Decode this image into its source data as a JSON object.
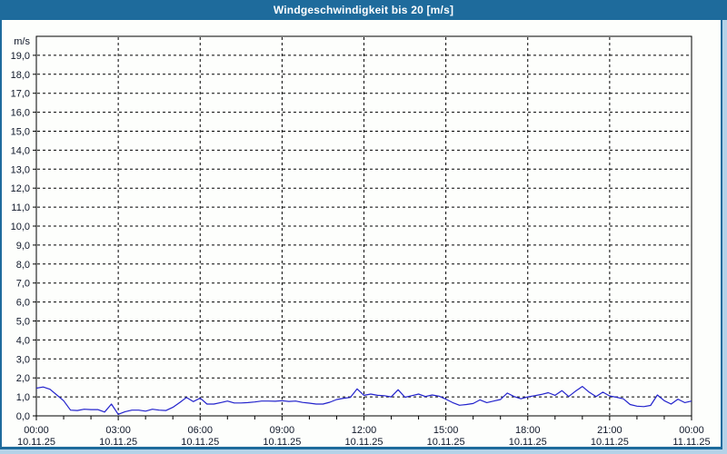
{
  "window": {
    "title": "Windgeschwindigkeit bis 20 [m/s]"
  },
  "colors": {
    "title_bar": "#1e6b9c",
    "frame_border": "#1e6b9c",
    "outer_background": "#b4d2e8",
    "panel_background": "#fdfefc",
    "grid": "#000000",
    "axis_text": "#10182a",
    "series": "#2222cc"
  },
  "chart_data": {
    "type": "line",
    "title": "Windgeschwindigkeit bis 20 [m/s]",
    "ylabel_unit": "m/s",
    "ylim": [
      0,
      20
    ],
    "ytick_step": 1,
    "ytick_labels": [
      "19,0",
      "18,0",
      "17,0",
      "16,0",
      "15,0",
      "14,0",
      "13,0",
      "12,0",
      "11,0",
      "10,0",
      "9,0",
      "8,0",
      "7,0",
      "6,0",
      "5,0",
      "4,0",
      "3,0",
      "2,0",
      "1,0",
      "0,0"
    ],
    "xlim_hours": [
      0,
      24
    ],
    "xtick_minor_step_hours": 1,
    "xtick_major_step_hours": 3,
    "grid": "dashed",
    "legend": "none",
    "xtick_labels": [
      {
        "time": "00:00",
        "date": "10.11.25"
      },
      {
        "time": "03:00",
        "date": "10.11.25"
      },
      {
        "time": "06:00",
        "date": "10.11.25"
      },
      {
        "time": "09:00",
        "date": "10.11.25"
      },
      {
        "time": "12:00",
        "date": "10.11.25"
      },
      {
        "time": "15:00",
        "date": "10.11.25"
      },
      {
        "time": "18:00",
        "date": "10.11.25"
      },
      {
        "time": "21:00",
        "date": "10.11.25"
      },
      {
        "time": "00:00",
        "date": "11.11.25"
      }
    ],
    "series": [
      {
        "name": "Windgeschwindigkeit",
        "unit": "m/s",
        "x_start_hour": 0,
        "x_step_hours": 0.25,
        "values": [
          1.46,
          1.52,
          1.4,
          1.1,
          0.8,
          0.3,
          0.28,
          0.35,
          0.33,
          0.33,
          0.2,
          0.62,
          0.08,
          0.22,
          0.3,
          0.3,
          0.25,
          0.35,
          0.3,
          0.28,
          0.45,
          0.7,
          0.97,
          0.75,
          0.94,
          0.62,
          0.62,
          0.7,
          0.78,
          0.68,
          0.68,
          0.7,
          0.73,
          0.78,
          0.78,
          0.77,
          0.8,
          0.76,
          0.78,
          0.71,
          0.67,
          0.62,
          0.62,
          0.72,
          0.86,
          0.93,
          0.97,
          1.42,
          1.08,
          1.15,
          1.08,
          1.06,
          1.0,
          1.38,
          0.98,
          1.06,
          1.15,
          1.02,
          1.1,
          1.04,
          0.88,
          0.7,
          0.56,
          0.6,
          0.65,
          0.84,
          0.7,
          0.78,
          0.86,
          1.2,
          1.02,
          0.9,
          1.0,
          1.06,
          1.13,
          1.22,
          1.08,
          1.33,
          1.02,
          1.3,
          1.55,
          1.25,
          1.02,
          1.25,
          1.05,
          0.98,
          0.9,
          0.6,
          0.51,
          0.49,
          0.55,
          1.1,
          0.8,
          0.62,
          0.88,
          0.7,
          0.78
        ]
      }
    ]
  }
}
